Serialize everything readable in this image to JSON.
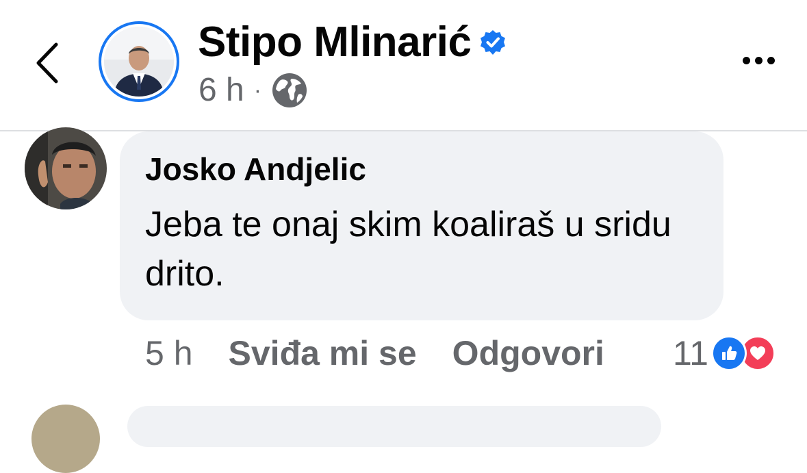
{
  "post": {
    "author_name": "Stipo Mlinarić",
    "verified": true,
    "time": "6 h",
    "separator": "·",
    "audience_icon": "globe-icon"
  },
  "header": {
    "back_icon": "chevron-left-icon",
    "more_icon": "more-horizontal-icon"
  },
  "comment": {
    "author": "Josko Andjelic",
    "text": "Jeba te onaj skim koaliraš u sridu drito.",
    "time": "5 h",
    "like_label": "Sviđa mi se",
    "reply_label": "Odgovori",
    "reaction_count": "11",
    "reactions": [
      "like-icon",
      "love-icon"
    ]
  },
  "colors": {
    "accent": "#1877f2",
    "secondary_text": "#65676b",
    "bubble": "#f0f2f5",
    "love": "#f33e58"
  }
}
